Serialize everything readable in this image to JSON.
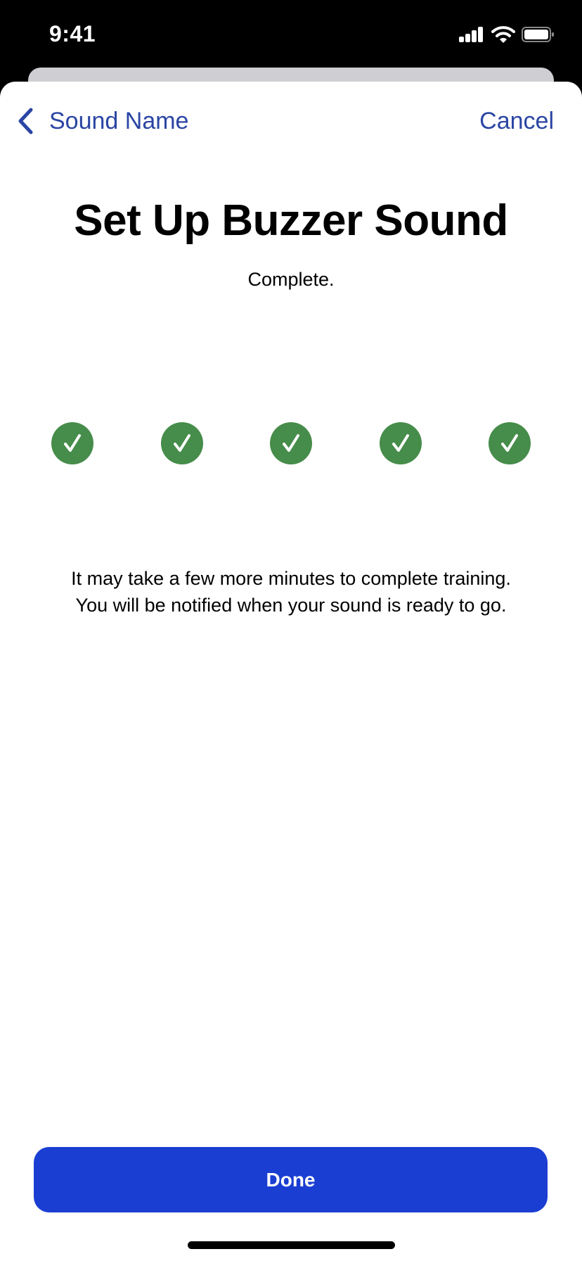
{
  "status_bar": {
    "time": "9:41",
    "icons": [
      "cellular-signal-icon",
      "wifi-icon",
      "battery-icon"
    ]
  },
  "nav": {
    "back_label": "Sound Name",
    "back_icon": "chevron-left-icon",
    "cancel_label": "Cancel"
  },
  "header": {
    "title": "Set Up Buzzer Sound",
    "subtitle": "Complete."
  },
  "progress": {
    "steps_total": 5,
    "steps_completed": 5,
    "step_icon": "checkmark-circle-icon"
  },
  "info": {
    "line1": "It may take a few more minutes to complete training.",
    "line2": "You will be notified when your sound is ready to go."
  },
  "actions": {
    "done_label": "Done"
  },
  "colors": {
    "accent": "#2a45a3",
    "button": "#1b3ed2",
    "success": "#468c4a"
  }
}
